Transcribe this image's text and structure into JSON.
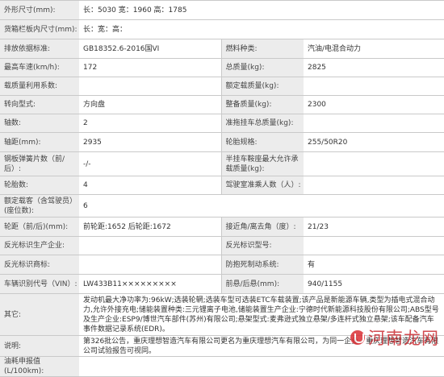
{
  "rows": [
    {
      "l1": "外形尺寸(mm):",
      "v1": "长：5030 宽：1960 高：1785",
      "span": true
    },
    {
      "l1": "货箱栏板内尺寸(mm):",
      "v1": "长：宽：高：",
      "span": true
    },
    {
      "l1": "排放依据标准:",
      "v1": "GB18352.6-2016国VI",
      "l2": "燃料种类:",
      "v2": "汽油/电混合动力"
    },
    {
      "l1": "最高车速(km/h):",
      "v1": "172",
      "l2": "总质量(kg):",
      "v2": "2825"
    },
    {
      "l1": "载质量利用系数:",
      "v1": "",
      "l2": "额定载质量(kg):",
      "v2": ""
    },
    {
      "l1": "转向型式:",
      "v1": "方向盘",
      "l2": "整备质量(kg):",
      "v2": "2300"
    },
    {
      "l1": "轴数:",
      "v1": "2",
      "l2": "准拖挂车总质量(kg):",
      "v2": ""
    },
    {
      "l1": "轴距(mm):",
      "v1": "2935",
      "l2": "轮胎规格:",
      "v2": "255/50R20"
    },
    {
      "l1": "钢板弹簧片数（前/后）:",
      "v1": "-/-",
      "l2": "半挂车鞍座最大允许承载质量(kg):",
      "v2": ""
    },
    {
      "l1": "轮胎数:",
      "v1": "4",
      "l2": "驾驶室准乘人数（人）:",
      "v2": ""
    },
    {
      "l1": "额定载客（含驾驶员）(座位数):",
      "v1": "6",
      "span": true
    },
    {
      "l1": "轮距（前/后)(mm):",
      "v1": "前轮距:1652 后轮距:1672",
      "l2": "接近角/离去角（度）:",
      "v2": "21/23"
    },
    {
      "l1": "反光标识生产企业:",
      "v1": "",
      "l2": "反光标识型号:",
      "v2": ""
    },
    {
      "l1": "反光标识商标:",
      "v1": "",
      "l2": "防抱死制动系统:",
      "v2": "有"
    },
    {
      "l1": "车辆识别代号（VIN）:",
      "v1": "LW433B11×××××××××",
      "l2": "前悬/后悬(mm):",
      "v2": "940/1155"
    },
    {
      "l1": "其它:",
      "v1": "发动机最大净功率为:96kW;选装轮辋;选装车型可选装ETC车载装置;该产品是新能源车辆,类型为插电式混合动力,允许外接充电;储能装置种类:三元锂离子电池,储能装置生产企业:宁德时代新能源科技股份有限公司;ABS型号及生产企业:ESP9/博世汽车部件(苏州)有限公司;悬架型式:麦弗逊式独立悬架/多连杆式独立悬架;该车配备汽车事件数据记录系统(EDR)。",
      "span": true
    },
    {
      "l1": "说明:",
      "v1": "第326批公告，重庆理想智造汽车有限公司更名为重庆理想汽车有限公司，为同一企业。重庆理想智造汽车有限公司试验报告可视同。",
      "span": true
    },
    {
      "l1": "油耗申报值(L/100km):",
      "v1": "",
      "span": true
    }
  ],
  "watermark": {
    "text": "河南龙网",
    "logo_icon": "red-circle-logo"
  }
}
